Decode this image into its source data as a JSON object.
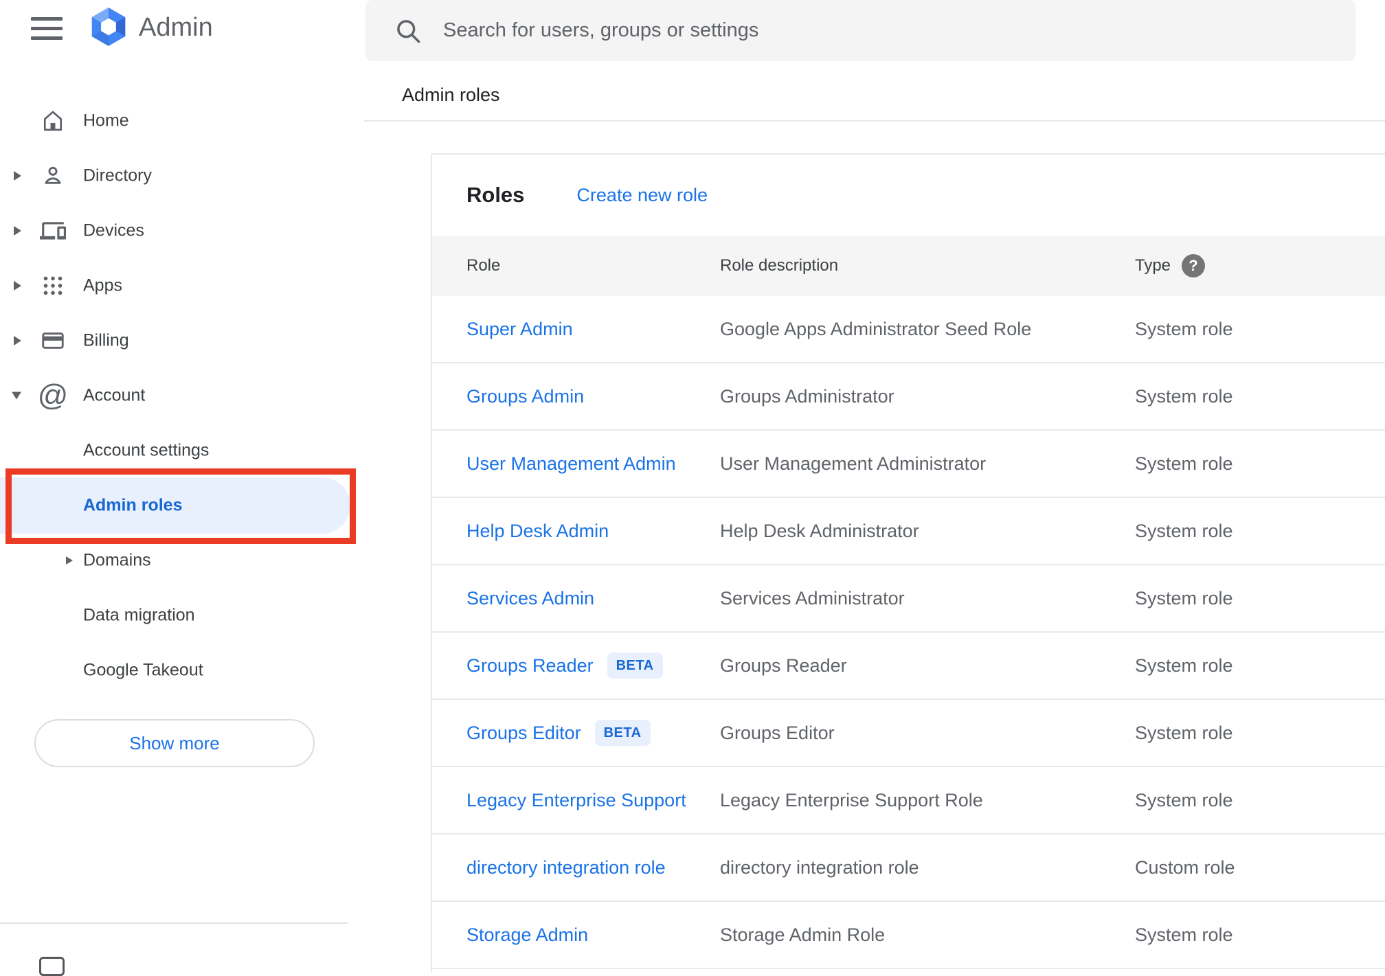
{
  "app": {
    "title": "Admin"
  },
  "search": {
    "placeholder": "Search for users, groups or settings"
  },
  "breadcrumb": "Admin roles",
  "sidebar": {
    "items": [
      {
        "label": "Home"
      },
      {
        "label": "Directory"
      },
      {
        "label": "Devices"
      },
      {
        "label": "Apps"
      },
      {
        "label": "Billing"
      },
      {
        "label": "Account"
      },
      {
        "label": "Account settings"
      },
      {
        "label": "Admin roles"
      },
      {
        "label": "Domains"
      },
      {
        "label": "Data migration"
      },
      {
        "label": "Google Takeout"
      }
    ],
    "selected_item": "Admin roles",
    "show_more_label": "Show more"
  },
  "icons": {
    "help": "?"
  },
  "main": {
    "card_title": "Roles",
    "create_link": "Create new role",
    "columns": [
      "Role",
      "Role description",
      "Type"
    ],
    "rows": [
      {
        "role": "Super Admin",
        "description": "Google Apps Administrator Seed Role",
        "type": "System role"
      },
      {
        "role": "Groups Admin",
        "description": "Groups Administrator",
        "type": "System role"
      },
      {
        "role": "User Management Admin",
        "description": "User Management Administrator",
        "type": "System role"
      },
      {
        "role": "Help Desk Admin",
        "description": "Help Desk Administrator",
        "type": "System role"
      },
      {
        "role": "Services Admin",
        "description": "Services Administrator",
        "type": "System role"
      },
      {
        "role": "Groups Reader",
        "badge": "BETA",
        "description": "Groups Reader",
        "type": "System role"
      },
      {
        "role": "Groups Editor",
        "badge": "BETA",
        "description": "Groups Editor",
        "type": "System role"
      },
      {
        "role": "Legacy Enterprise Support",
        "description": "Legacy Enterprise Support Role",
        "type": "System role"
      },
      {
        "role": "directory integration role",
        "description": "directory integration role",
        "type": "Custom role"
      },
      {
        "role": "Storage Admin",
        "description": "Storage Admin Role",
        "type": "System role"
      }
    ]
  },
  "colors": {
    "link_blue": "#1a73e8",
    "selected_blue": "#1967d2",
    "selected_bg": "#e8f0fe",
    "annotation_red": "#ea3b24",
    "header_gray_bg": "#f5f5f5",
    "icon_gray": "#5f6368"
  }
}
